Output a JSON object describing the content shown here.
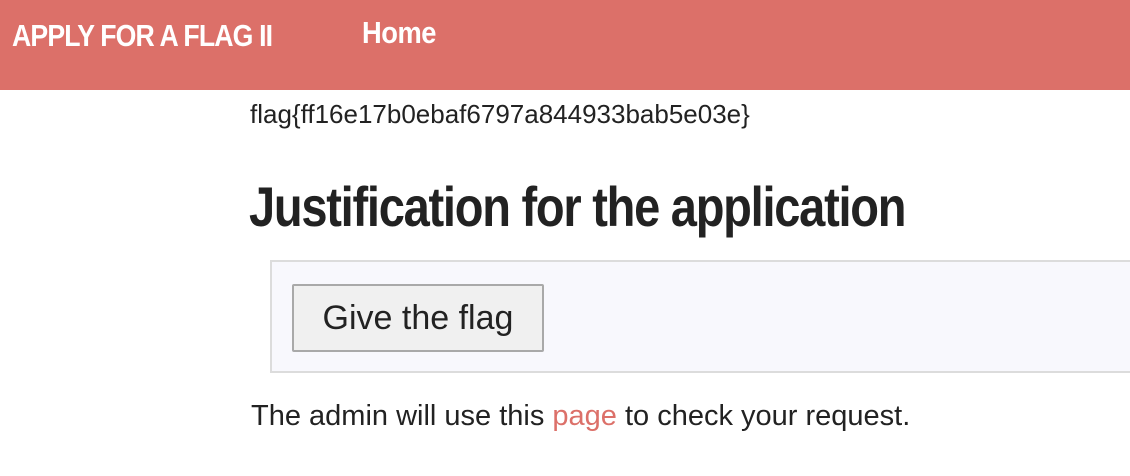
{
  "navbar": {
    "brand": "APPLY FOR A FLAG II",
    "home_label": "Home",
    "background_color": "#dc7069"
  },
  "main": {
    "flag_value": "flag{ff16e17b0ebaf6797a844933bab5e03e}",
    "title": "Justification for the application",
    "form": {
      "submit_label": "Give the flag"
    },
    "footer": {
      "prefix": "The admin will use this ",
      "link_label": "page",
      "suffix": " to check your request.",
      "link_color": "#dc7069"
    }
  }
}
